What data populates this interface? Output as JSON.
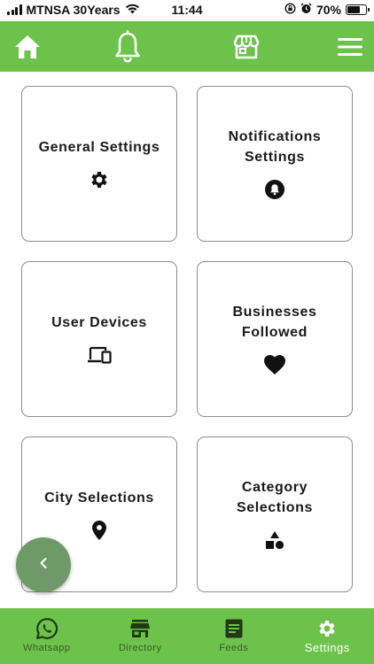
{
  "status_bar": {
    "carrier": "MTNSA 30Years",
    "time": "11:44",
    "battery": "70%",
    "battery_level": 0.7
  },
  "top_bar": {
    "icons": [
      "home-icon",
      "bell-icon",
      "store-icon",
      "menu-icon"
    ]
  },
  "cards": [
    {
      "title": "General Settings",
      "icon": "gear-icon"
    },
    {
      "title": "Notifications Settings",
      "icon": "bell-circle-icon"
    },
    {
      "title": "User Devices",
      "icon": "devices-icon"
    },
    {
      "title": "Businesses Followed",
      "icon": "heart-icon"
    },
    {
      "title": "City Selections",
      "icon": "location-pin-icon"
    },
    {
      "title": "Category Selections",
      "icon": "shapes-icon"
    }
  ],
  "fab": {
    "icon": "chevron-left-icon"
  },
  "bottom_nav": {
    "items": [
      {
        "label": "Whatsapp",
        "icon": "whatsapp-icon",
        "active": false
      },
      {
        "label": "Directory",
        "icon": "store-icon",
        "active": false
      },
      {
        "label": "Feeds",
        "icon": "document-icon",
        "active": false
      },
      {
        "label": "Settings",
        "icon": "gear-icon",
        "active": true
      }
    ]
  },
  "colors": {
    "primary_green": "#6cc24a",
    "fab_green": "#6e9a67",
    "inactive_label": "#3a5b2c",
    "active_label": "#ffffff"
  }
}
